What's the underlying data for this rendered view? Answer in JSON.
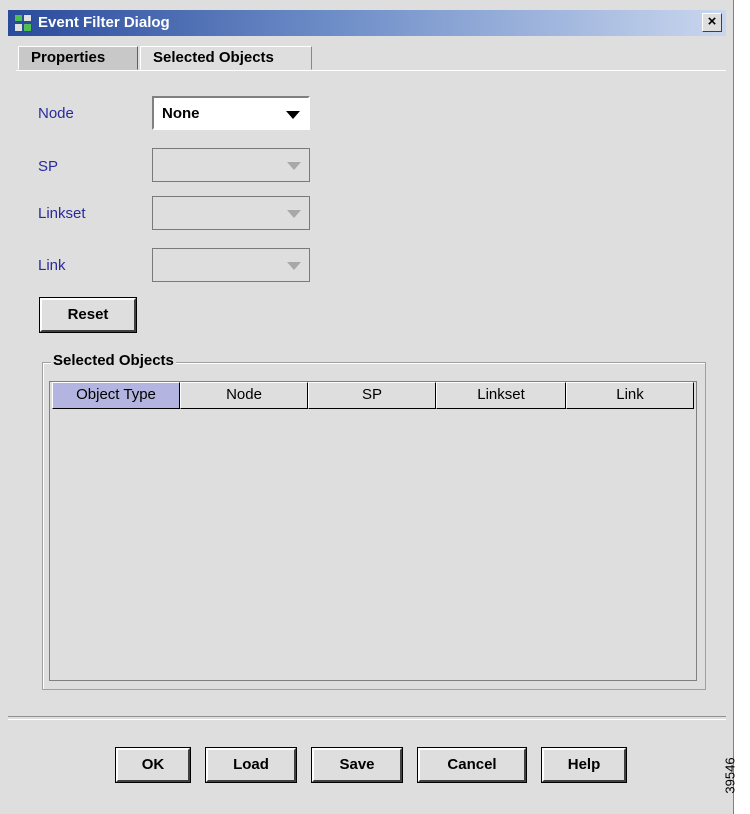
{
  "window": {
    "title": "Event Filter Dialog",
    "close_label": "×"
  },
  "tabs": [
    {
      "label": "Properties"
    },
    {
      "label": "Selected Objects"
    }
  ],
  "fields": [
    {
      "label": "Node",
      "value": "None"
    },
    {
      "label": "SP",
      "value": ""
    },
    {
      "label": "Linkset",
      "value": ""
    },
    {
      "label": "Link",
      "value": ""
    }
  ],
  "reset_label": "Reset",
  "selected_objects": {
    "title": "Selected Objects",
    "columns": [
      "Object Type",
      "Node",
      "SP",
      "Linkset",
      "Link"
    ]
  },
  "buttons": {
    "ok": "OK",
    "load": "Load",
    "save": "Save",
    "cancel": "Cancel",
    "help": "Help"
  },
  "figure_id": "39546"
}
